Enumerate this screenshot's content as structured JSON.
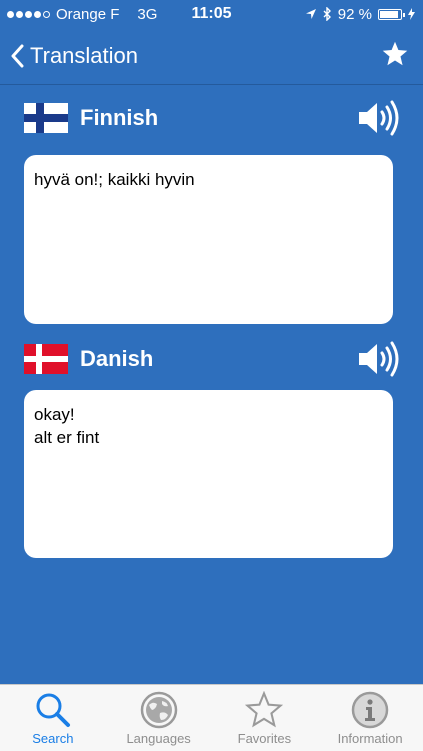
{
  "status": {
    "carrier": "Orange F",
    "network": "3G",
    "time": "11:05",
    "battery": "92 %",
    "battery_level": 0.92
  },
  "nav": {
    "back_label": "Translation",
    "favorite_icon": "star-icon"
  },
  "source": {
    "language": "Finnish",
    "flag": "finland-flag-icon",
    "lines": [
      "hyvä on!; kaikki hyvin"
    ]
  },
  "target": {
    "language": "Danish",
    "flag": "denmark-flag-icon",
    "lines": [
      "okay!",
      "alt er fint"
    ]
  },
  "tabs": [
    {
      "label": "Search",
      "icon": "search-icon",
      "active": true
    },
    {
      "label": "Languages",
      "icon": "globe-icon",
      "active": false
    },
    {
      "label": "Favorites",
      "icon": "star-icon",
      "active": false
    },
    {
      "label": "Information",
      "icon": "info-icon",
      "active": false
    }
  ],
  "colors": {
    "background": "#2e6fbd",
    "active_tab": "#1a7ee6",
    "inactive_tab": "#8e8e8e"
  }
}
